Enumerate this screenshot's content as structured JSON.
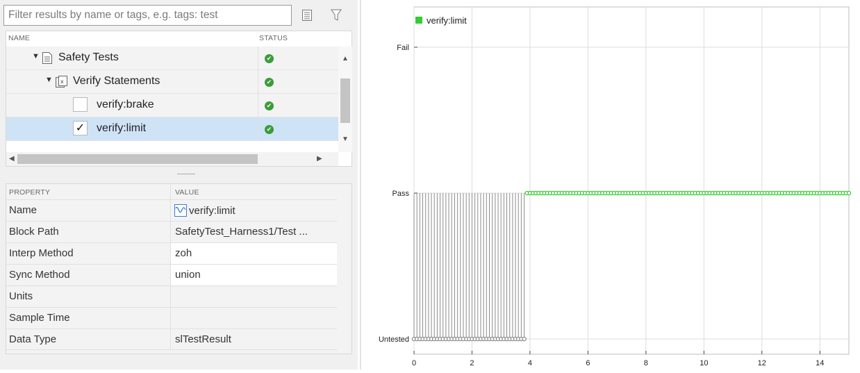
{
  "search": {
    "placeholder": "Filter results by name or tags, e.g. tags: test"
  },
  "toolbar": {
    "list_icon": "list-icon",
    "filter_icon": "filter-icon"
  },
  "tree": {
    "headers": {
      "name": "NAME",
      "status": "STATUS"
    },
    "rows": [
      {
        "label": "Safety Tests",
        "icon": "test-file-icon",
        "expanded": true,
        "status": "passed"
      },
      {
        "label": "Verify Statements",
        "icon": "test-suite-icon",
        "expanded": true,
        "status": "passed"
      },
      {
        "label": "verify:brake",
        "checked": false,
        "status": "passed"
      },
      {
        "label": "verify:limit",
        "checked": true,
        "selected": true,
        "status": "passed"
      }
    ]
  },
  "properties": {
    "headers": {
      "property": "PROPERTY",
      "value": "VALUE"
    },
    "rows": [
      {
        "name": "Name",
        "value": "verify:limit",
        "icon": "signal-icon"
      },
      {
        "name": "Block Path",
        "value": "SafetyTest_Harness1/Test ..."
      },
      {
        "name": "Interp Method",
        "value": "zoh"
      },
      {
        "name": "Sync Method",
        "value": "union"
      },
      {
        "name": "Units",
        "value": ""
      },
      {
        "name": "Sample Time",
        "value": ""
      },
      {
        "name": "Data Type",
        "value": "slTestResult"
      }
    ]
  },
  "chart_data": {
    "type": "scatter",
    "legend": [
      "verify:limit"
    ],
    "legend_position": "top-left",
    "y_categories": [
      "Untested",
      "Pass",
      "Fail"
    ],
    "xlim": [
      0,
      15
    ],
    "x_ticks": [
      0,
      2,
      4,
      6,
      8,
      10,
      12,
      14
    ],
    "grid": true,
    "series": [
      {
        "name": "verify:limit",
        "state": "Untested",
        "x_range": [
          0,
          3.8
        ],
        "step": 0.1,
        "color": "#8c8c8c",
        "stem_to": "Pass"
      },
      {
        "name": "verify:limit",
        "state": "Pass",
        "x_range": [
          3.9,
          15
        ],
        "step": 0.1,
        "color": "#33cc33"
      }
    ]
  }
}
